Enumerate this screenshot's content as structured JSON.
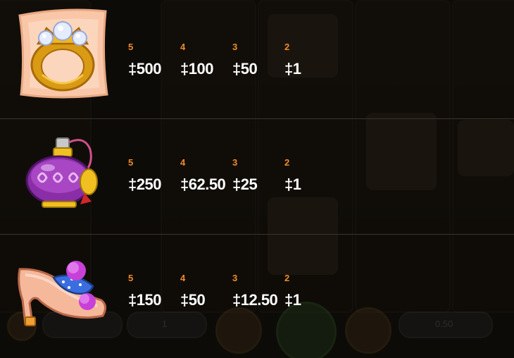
{
  "paytable": {
    "rows": [
      {
        "symbol": "ring-icon",
        "pays": [
          {
            "count": "5",
            "amount": "‡500"
          },
          {
            "count": "4",
            "amount": "‡100"
          },
          {
            "count": "3",
            "amount": "‡50"
          },
          {
            "count": "2",
            "amount": "‡1"
          }
        ]
      },
      {
        "symbol": "perfume-bottle-icon",
        "pays": [
          {
            "count": "5",
            "amount": "‡250"
          },
          {
            "count": "4",
            "amount": "‡62.50"
          },
          {
            "count": "3",
            "amount": "‡25"
          },
          {
            "count": "2",
            "amount": "‡1"
          }
        ]
      },
      {
        "symbol": "high-heel-shoe-icon",
        "pays": [
          {
            "count": "5",
            "amount": "‡150"
          },
          {
            "count": "4",
            "amount": "‡50"
          },
          {
            "count": "3",
            "amount": "‡12.50"
          },
          {
            "count": "2",
            "amount": "‡1"
          }
        ]
      }
    ]
  },
  "background_controls": {
    "bet_level_value": "1",
    "coin_value": "0.50"
  },
  "colors": {
    "count_text": "#f08a2a",
    "amount_text": "#ffffff",
    "background": "#0d0b08"
  }
}
